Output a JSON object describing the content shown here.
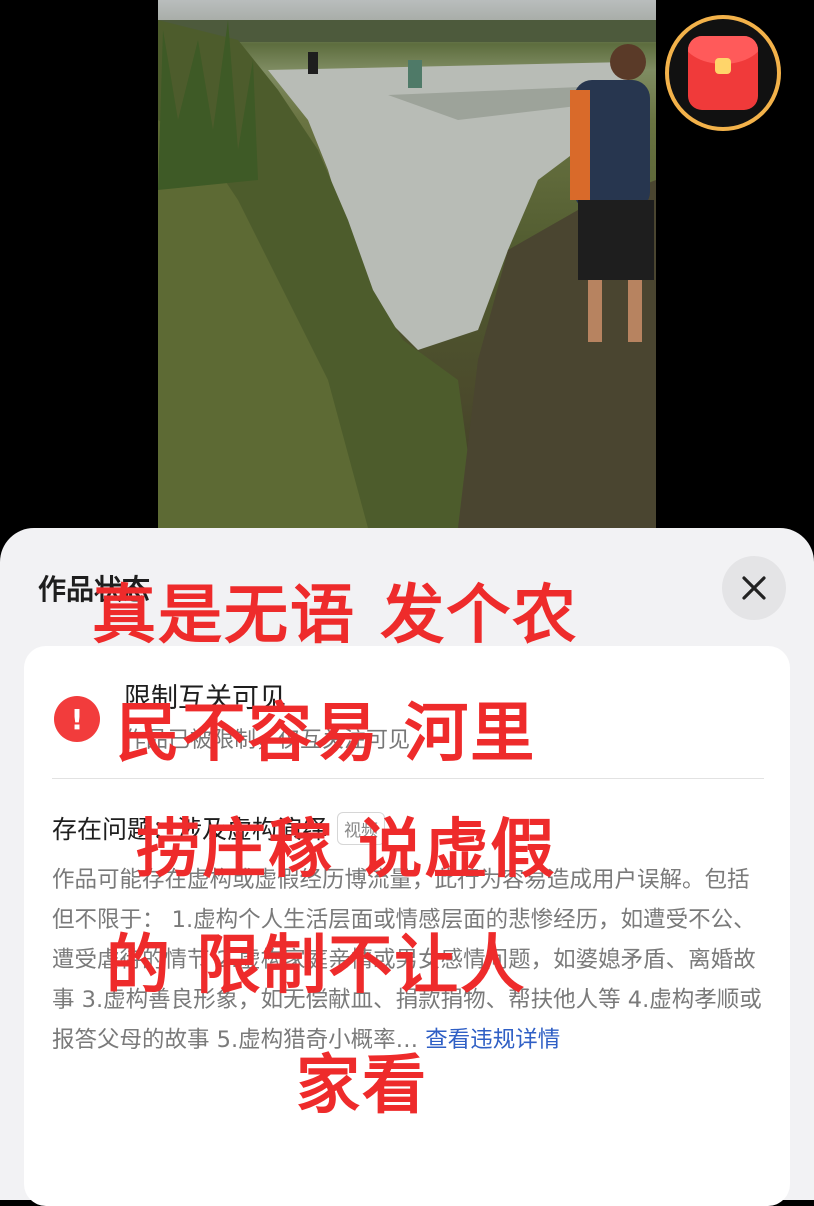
{
  "video": {
    "scene": "flooded-field"
  },
  "sheet": {
    "title": "作品状态",
    "close_icon": "close-icon"
  },
  "status": {
    "title": "限制互关可见",
    "description": "作品已被限制，仅互关注可见"
  },
  "issue": {
    "label": "存在问题：涉及虚构演绎",
    "tag": "视频",
    "body": "作品可能存在虚构或虚假经历博流量，此行为容易造成用户误解。包括但不限于： 1.虚构个人生活层面或情感层面的悲惨经历，如遭受不公、遭受虐待的情节 2.虚构家庭亲情或男女感情问题，如婆媳矛盾、离婚故事 3.虚构善良形象，如无偿献血、捐款捐物、帮扶他人等 4.虚构孝顺或报答父母的故事 5.虚构猎奇小概率…",
    "link": "查看违规详情"
  },
  "overlay": {
    "line1": "真是无语  发个农",
    "line2": "民不容易    河里",
    "line3": "捞庄稼    说虚假",
    "line4": "的    限制不让人",
    "line5": "家看"
  },
  "colors": {
    "overlay_red": "#ee2b2b",
    "warn_red": "#f23c3c",
    "link_blue": "#2f5fc5",
    "redpacket_ring": "#f3b24a"
  }
}
